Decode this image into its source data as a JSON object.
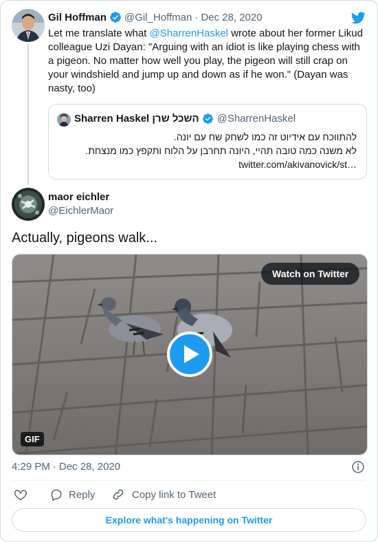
{
  "colors": {
    "accent": "#1d9bf0",
    "text": "#0f1419",
    "muted": "#536471",
    "border": "#cfd9de"
  },
  "tweet1": {
    "display_name": "Gil Hoffman",
    "verified_icon": "verified-badge-icon",
    "handle": "@Gil_Hoffman",
    "separator": "·",
    "date": "Dec 28, 2020",
    "text_prefix": "Let me translate what ",
    "mention": "@SharrenHaskel",
    "text_suffix": " wrote about her former Likud colleague Uzi Dayan: \"Arguing with an idiot is like playing chess with a pigeon. No matter how well you play, the pigeon will still crap on your windshield and jump up and down as if he won.\" (Dayan was nasty, too)"
  },
  "quote": {
    "display_name": "Sharren Haskel השכל שרן",
    "handle": "@SharrenHaskel",
    "line1": "להתווכח עם אידיוט זה כמו לשחק שח עם יונה.",
    "line2": "לא משנה כמה טובה תהיי, היונה תחרבן על הלוח ותקפץ כמו מנצחת.",
    "link": "twitter.com/akivanovick/st…"
  },
  "tweet2": {
    "display_name": "maor eichler",
    "handle": "@EichlerMaor",
    "text": "Actually, pigeons walk..."
  },
  "media": {
    "watch_label": "Watch on Twitter",
    "gif_label": "GIF",
    "play_icon": "play-icon"
  },
  "footer": {
    "time": "4:29 PM",
    "separator": "·",
    "date": "Dec 28, 2020",
    "reply_label": "Reply",
    "copy_label": "Copy link to Tweet",
    "explore_label": "Explore what's happening on Twitter"
  }
}
